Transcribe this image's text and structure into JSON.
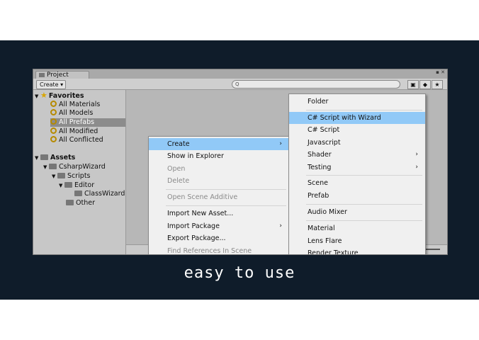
{
  "window": {
    "tab_label": "Project",
    "window_controls": "▪ ✕"
  },
  "toolbar": {
    "create_label": "Create ▾",
    "search_placeholder": "Q",
    "icon_scene": "▣",
    "icon_tag": "◆",
    "icon_star": "★"
  },
  "tree": {
    "favorites_label": "Favorites",
    "favorites": [
      "All Materials",
      "All Models",
      "All Prefabs",
      "All Modified",
      "All Conflicted"
    ],
    "selected_favorite": "All Prefabs",
    "assets_label": "Assets",
    "csharpwizard": "CsharpWizard",
    "scripts": "Scripts",
    "editor": "Editor",
    "classwizard": "ClassWizard",
    "other": "Other"
  },
  "context_menu": {
    "items": [
      {
        "label": "Create",
        "submenu": "›",
        "state": "highlighted"
      },
      {
        "label": "Show in Explorer",
        "state": "normal"
      },
      {
        "label": "Open",
        "state": "disabled"
      },
      {
        "label": "Delete",
        "state": "disabled"
      },
      {
        "label": "Open Scene Additive",
        "state": "disabled"
      },
      {
        "label": "Import New Asset...",
        "state": "normal"
      },
      {
        "label": "Import Package",
        "submenu": "›",
        "state": "normal"
      },
      {
        "label": "Export Package...",
        "state": "normal"
      },
      {
        "label": "Find References In Scene",
        "state": "disabled"
      }
    ]
  },
  "create_submenu": {
    "items": [
      {
        "label": "Folder"
      },
      {
        "label": "C# Script with Wizard",
        "state": "highlighted"
      },
      {
        "label": "C# Script"
      },
      {
        "label": "Javascript"
      },
      {
        "label": "Shader",
        "submenu": "›"
      },
      {
        "label": "Testing",
        "submenu": "›"
      },
      {
        "label": "Scene"
      },
      {
        "label": "Prefab"
      },
      {
        "label": "Audio Mixer"
      },
      {
        "label": "Material"
      },
      {
        "label": "Lens Flare"
      },
      {
        "label": "Render Texture"
      }
    ]
  },
  "caption": "easy to use",
  "colors": {
    "frame_bg": "#0f1c2a",
    "highlight": "#91c9f7",
    "caption_text": "#ffffff"
  }
}
